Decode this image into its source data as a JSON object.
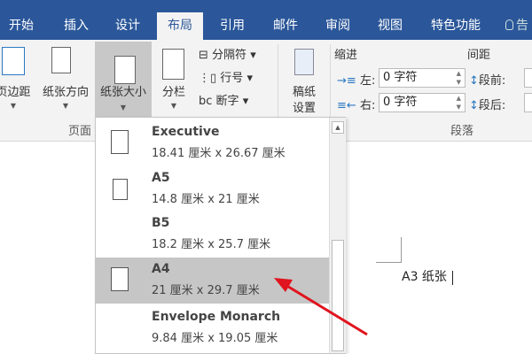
{
  "tabs": [
    "开始",
    "插入",
    "设计",
    "布局",
    "引用",
    "邮件",
    "审阅",
    "视图",
    "特色功能",
    "告"
  ],
  "ribbon": {
    "margins": "页边距",
    "orientation": "纸张方向",
    "size": "纸张大小",
    "columns": "分栏",
    "breaks": "分隔符",
    "line_numbers": "行号",
    "hyphenation": "断字",
    "manuscript": [
      "稿纸",
      "设置"
    ],
    "page_setup_group": "页面",
    "indent_title": "缩进",
    "spacing_title": "间距",
    "indent_left_label": "左:",
    "indent_left_value": "0 字符",
    "indent_right_label": "右:",
    "indent_right_value": "0 字符",
    "space_before_label": "段前:",
    "space_after_label": "段后:",
    "paragraph_group": "段落"
  },
  "dropdown": {
    "items": [
      {
        "name": "Executive",
        "size": "18.41 厘米 x 26.67 厘米"
      },
      {
        "name": "A5",
        "size": "14.8 厘米 x 21 厘米"
      },
      {
        "name": "B5",
        "size": "18.2 厘米 x 25.7 厘米"
      },
      {
        "name": "A4",
        "size": "21 厘米 x 29.7 厘米",
        "selected": true
      },
      {
        "name": "Envelope Monarch",
        "size": "9.84 厘米 x 19.05 厘米"
      }
    ]
  },
  "document": {
    "text": "A3 纸张"
  },
  "colors": {
    "accent": "#2b579a",
    "arrow": "#e0141e"
  }
}
